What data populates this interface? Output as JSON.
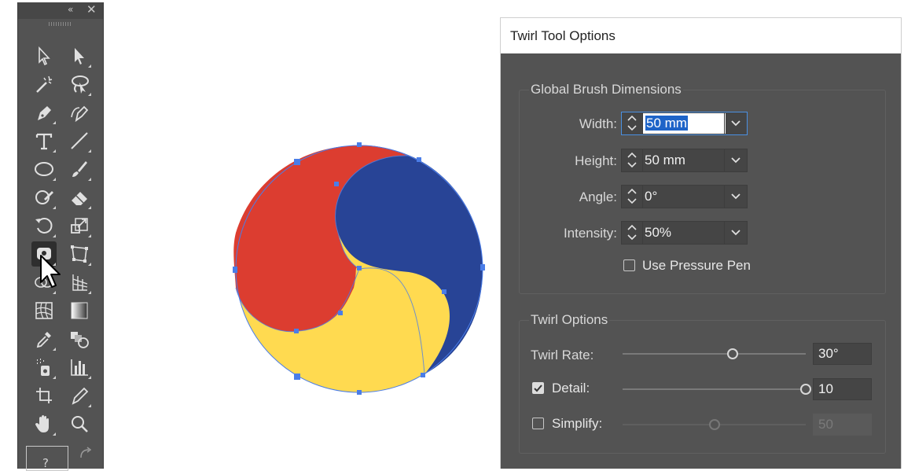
{
  "toolbar": {
    "collapse_glyph": "«",
    "close_glyph": "✕",
    "fill_stroke_label": "?",
    "tools": [
      {
        "name": "selection-tool",
        "icon": "arrow-outline-icon"
      },
      {
        "name": "direct-selection-tool",
        "icon": "arrow-filled-icon"
      },
      {
        "name": "magic-wand-tool",
        "icon": "magic-wand-icon"
      },
      {
        "name": "lasso-tool",
        "icon": "lasso-icon"
      },
      {
        "name": "pen-tool",
        "icon": "pen-icon"
      },
      {
        "name": "curvature-tool",
        "icon": "curvature-pen-icon"
      },
      {
        "name": "type-tool",
        "icon": "type-icon"
      },
      {
        "name": "line-tool",
        "icon": "line-icon"
      },
      {
        "name": "ellipse-tool",
        "icon": "ellipse-icon"
      },
      {
        "name": "paintbrush-tool",
        "icon": "paintbrush-icon"
      },
      {
        "name": "shaper-tool",
        "icon": "shaper-icon"
      },
      {
        "name": "eraser-tool",
        "icon": "eraser-icon"
      },
      {
        "name": "rotate-tool",
        "icon": "rotate-icon"
      },
      {
        "name": "scale-tool",
        "icon": "scale-icon"
      },
      {
        "name": "twirl-tool",
        "icon": "twirl-icon",
        "active": true
      },
      {
        "name": "free-transform-tool",
        "icon": "free-transform-icon"
      },
      {
        "name": "shape-builder-tool",
        "icon": "shape-builder-icon"
      },
      {
        "name": "perspective-grid-tool",
        "icon": "perspective-grid-icon"
      },
      {
        "name": "mesh-tool",
        "icon": "mesh-icon"
      },
      {
        "name": "gradient-tool",
        "icon": "gradient-icon"
      },
      {
        "name": "eyedropper-tool",
        "icon": "eyedropper-icon"
      },
      {
        "name": "blend-tool",
        "icon": "blend-icon"
      },
      {
        "name": "symbol-sprayer-tool",
        "icon": "symbol-sprayer-icon"
      },
      {
        "name": "column-graph-tool",
        "icon": "column-graph-icon"
      },
      {
        "name": "artboard-tool",
        "icon": "artboard-icon"
      },
      {
        "name": "slice-tool",
        "icon": "slice-icon"
      },
      {
        "name": "hand-tool",
        "icon": "hand-icon"
      },
      {
        "name": "zoom-tool",
        "icon": "zoom-icon"
      }
    ]
  },
  "canvas": {
    "colors": {
      "red": "#dc3d30",
      "blue": "#284496",
      "yellow": "#ffda50",
      "selection": "#4a7de8"
    }
  },
  "dialog": {
    "title": "Twirl Tool Options",
    "global_brush": {
      "title": "Global Brush Dimensions",
      "width_label": "Width:",
      "width_value": "50 mm",
      "height_label": "Height:",
      "height_value": "50 mm",
      "angle_label": "Angle:",
      "angle_value": "0°",
      "intensity_label": "Intensity:",
      "intensity_value": "50%",
      "use_pressure_pen_label": "Use Pressure Pen",
      "use_pressure_pen_checked": false
    },
    "twirl_options": {
      "title": "Twirl Options",
      "twirl_rate_label": "Twirl Rate:",
      "twirl_rate_value": "30°",
      "twirl_rate_level": 0.6,
      "detail_label": "Detail:",
      "detail_checked": true,
      "detail_value": "10",
      "detail_level": 1.0,
      "simplify_label": "Simplify:",
      "simplify_checked": false,
      "simplify_value": "50",
      "simplify_level": 0.5
    }
  }
}
